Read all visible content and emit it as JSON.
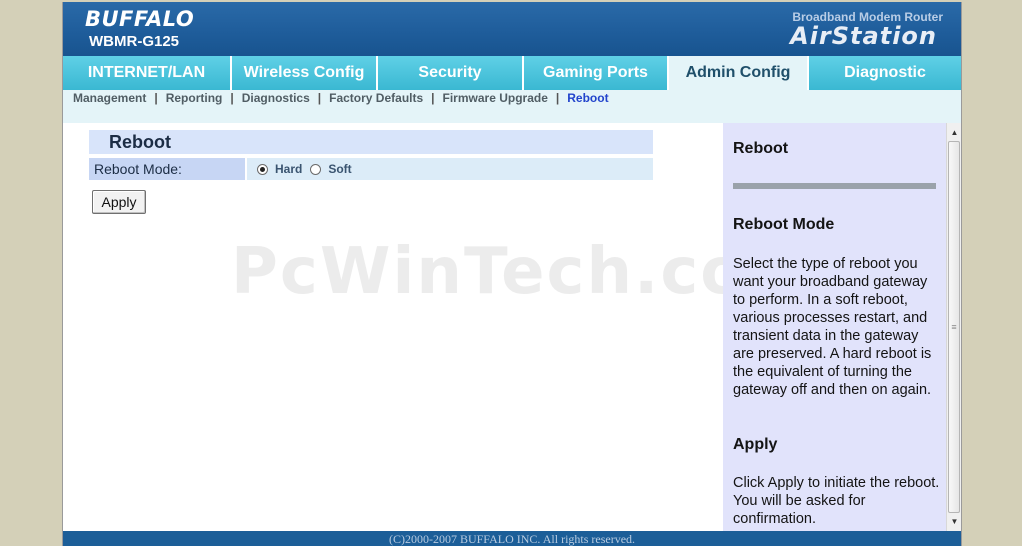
{
  "header": {
    "brand": "BUFFALO",
    "model": "WBMR-G125",
    "product_sub": "Broadband Modem Router",
    "product_name": "AirStation"
  },
  "tabs": [
    {
      "label": "INTERNET/LAN",
      "active": false
    },
    {
      "label": "Wireless Config",
      "active": false
    },
    {
      "label": "Security",
      "active": false
    },
    {
      "label": "Gaming Ports",
      "active": false
    },
    {
      "label": "Admin Config",
      "active": true
    },
    {
      "label": "Diagnostic",
      "active": false
    }
  ],
  "subnav": [
    {
      "label": "Management",
      "active": false
    },
    {
      "label": "Reporting",
      "active": false
    },
    {
      "label": "Diagnostics",
      "active": false
    },
    {
      "label": "Factory Defaults",
      "active": false
    },
    {
      "label": "Firmware Upgrade",
      "active": false
    },
    {
      "label": "Reboot",
      "active": true
    }
  ],
  "subnav_separator": "|",
  "main": {
    "section_title": "Reboot",
    "reboot_mode_label": "Reboot Mode:",
    "options": [
      {
        "label": "Hard",
        "selected": true
      },
      {
        "label": "Soft",
        "selected": false
      }
    ],
    "apply_label": "Apply"
  },
  "watermark": "PcWinTech.com",
  "help": {
    "title": "Reboot",
    "heading1": "Reboot Mode",
    "text1": "Select the type of reboot you want your broadband gateway to perform. In a soft reboot, various processes restart, and transient data in the gateway are preserved. A hard reboot is the equivalent of turning the gateway off and then on again.",
    "heading2": "Apply",
    "text2": "Click Apply to initiate the reboot. You will be asked for confirmation."
  },
  "footer": "(C)2000-2007 BUFFALO INC. All rights reserved.",
  "colors": {
    "header_blue": "#1e5c9a",
    "tab_cyan": "#3ab8d2",
    "active_sublink": "#2244cc",
    "help_bg": "#e1e3fb"
  }
}
